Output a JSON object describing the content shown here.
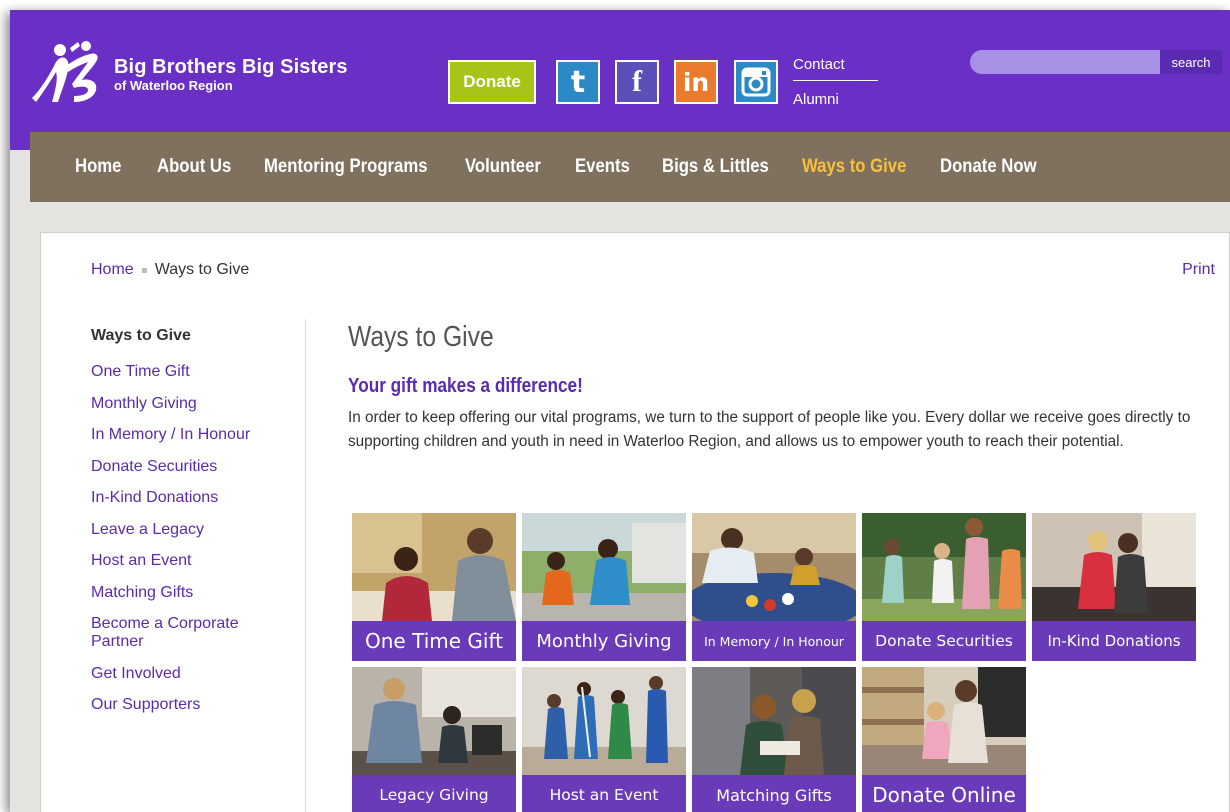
{
  "header": {
    "logo": {
      "title": "Big Brothers Big Sisters",
      "subtitle": "of Waterloo Region"
    },
    "donate_label": "Donate",
    "social": [
      {
        "name": "tumblr",
        "glyph": "t"
      },
      {
        "name": "facebook",
        "glyph": "f"
      },
      {
        "name": "linkedin",
        "glyph": "in"
      },
      {
        "name": "instagram",
        "glyph": "instagram-icon"
      }
    ],
    "util_links": {
      "contact": "Contact",
      "alumni": "Alumni"
    },
    "search": {
      "placeholder": "",
      "button": "search"
    }
  },
  "nav": {
    "items": [
      "Home",
      "About Us",
      "Mentoring Programs",
      "Volunteer",
      "Events",
      "Bigs & Littles",
      "Ways to Give",
      "Donate Now"
    ],
    "active": "Ways to Give"
  },
  "breadcrumb": {
    "home": "Home",
    "current": "Ways to Give"
  },
  "print_label": "Print",
  "sidebar": {
    "title": "Ways to Give",
    "items": [
      "One Time Gift",
      "Monthly Giving",
      "In Memory / In Honour",
      "Donate Securities",
      "In-Kind Donations",
      "Leave a Legacy",
      "Host an Event",
      "Matching Gifts",
      "Become a Corporate Partner",
      "Get Involved",
      "Our Supporters"
    ]
  },
  "main": {
    "title": "Ways to Give",
    "subtitle": "Your gift makes a difference!",
    "intro": "In order to keep offering our vital programs, we turn to the support of people like you.  Every dollar we receive goes directly to supporting children and youth in need in Waterloo Region, and allows us to empower youth to reach their potential."
  },
  "tiles": [
    {
      "label": "One Time Gift"
    },
    {
      "label": "Monthly Giving"
    },
    {
      "label": "In Memory / In Honour"
    },
    {
      "label": "Donate Securities"
    },
    {
      "label": "In-Kind Donations"
    },
    {
      "label": "Legacy Giving"
    },
    {
      "label": "Host an Event"
    },
    {
      "label": "Matching Gifts"
    },
    {
      "label": "Donate Online"
    }
  ],
  "colors": {
    "brand_purple": "#6a2fc4",
    "nav_brown": "#80705e",
    "active_nav": "#f7c03c",
    "link_purple": "#5a2bb0",
    "donate_green": "#a9c418"
  }
}
